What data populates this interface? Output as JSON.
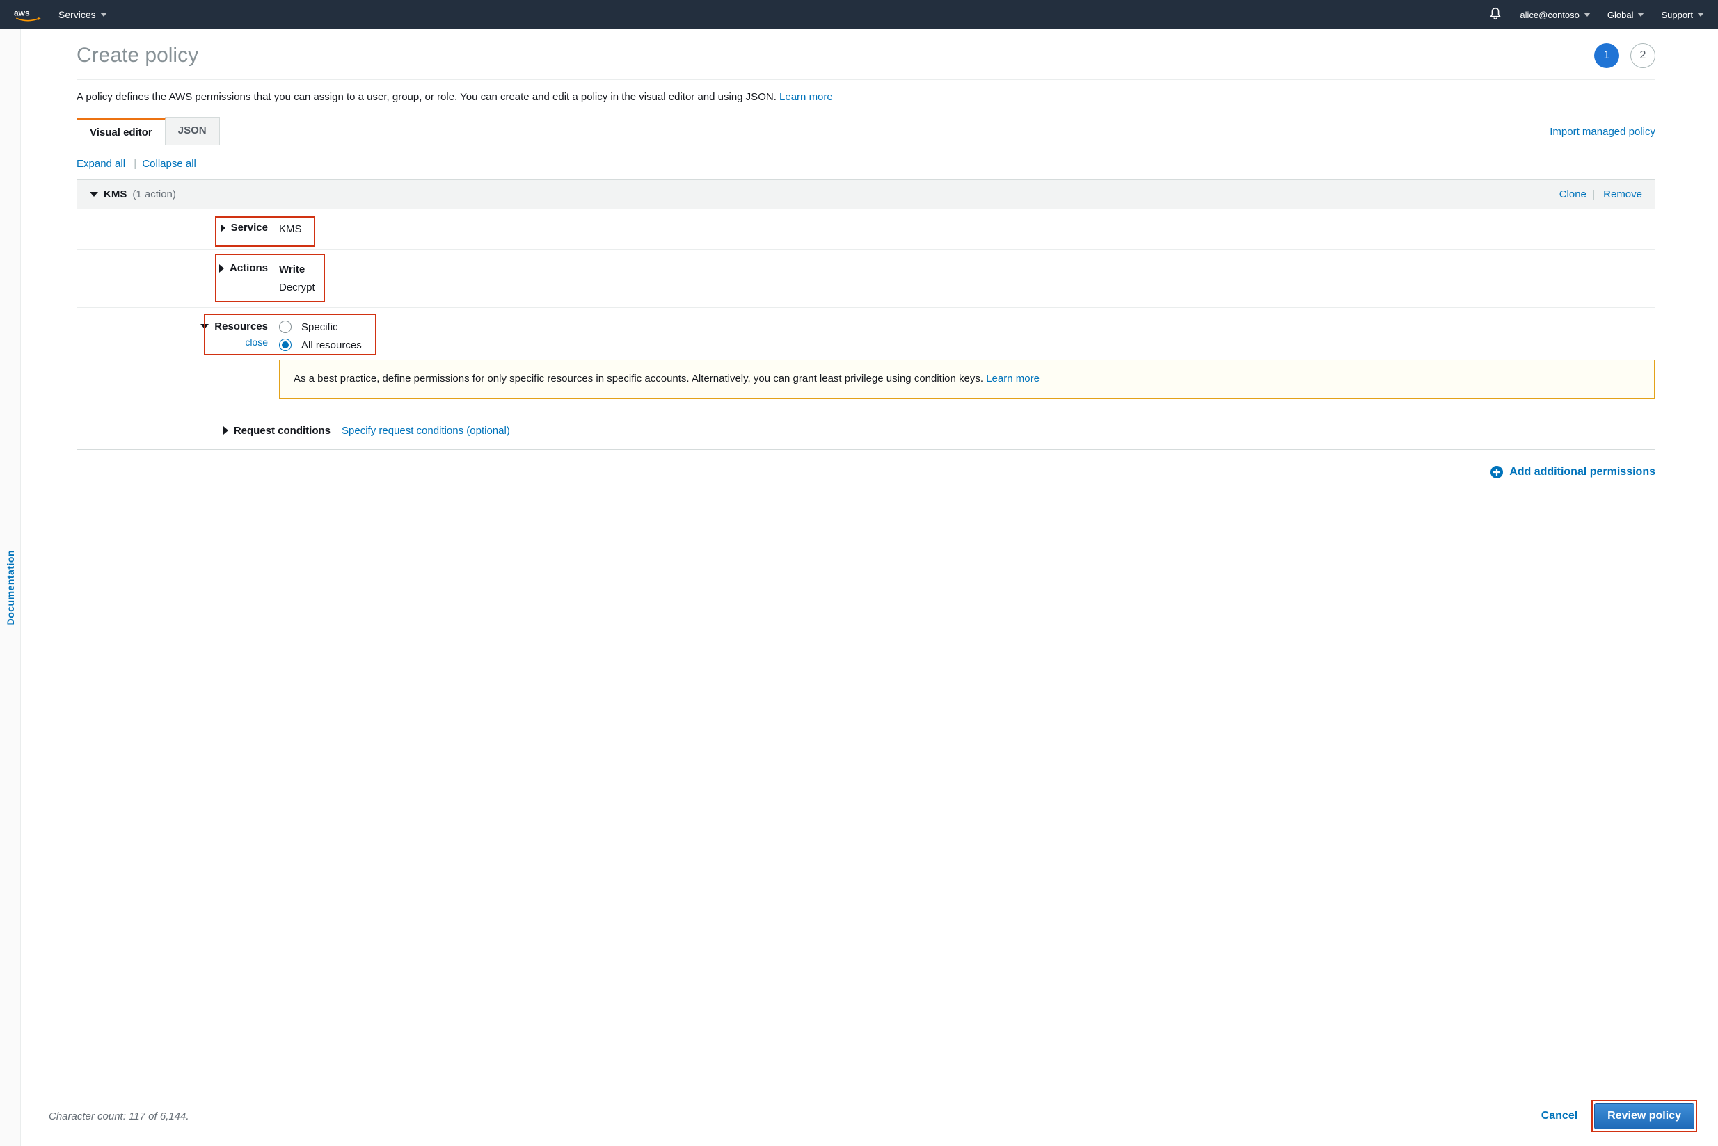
{
  "topnav": {
    "services": "Services",
    "user": "alice@contoso",
    "region": "Global",
    "support": "Support"
  },
  "sidebar": {
    "documentation": "Documentation"
  },
  "page": {
    "title": "Create policy",
    "step1": "1",
    "step2": "2",
    "intro": "A policy defines the AWS permissions that you can assign to a user, group, or role. You can create and edit a policy in the visual editor and using JSON. ",
    "learn_more": "Learn more"
  },
  "tabs": {
    "visual": "Visual editor",
    "json": "JSON",
    "import": "Import managed policy"
  },
  "toolbar": {
    "expand": "Expand all",
    "collapse": "Collapse all"
  },
  "block": {
    "service_name": "KMS",
    "count": "(1 action)",
    "clone": "Clone",
    "remove": "Remove",
    "service_label": "Service",
    "service_value": "KMS",
    "actions_label": "Actions",
    "actions_top": "Write",
    "actions_sub": "Decrypt",
    "resources_label": "Resources",
    "resources_close": "close",
    "radio_specific": "Specific",
    "radio_all": "All resources",
    "warning": "As a best practice, define permissions for only specific resources in specific accounts. Alternatively, you can grant least privilege using condition keys. ",
    "conditions_label": "Request conditions",
    "conditions_value": "Specify request conditions (optional)"
  },
  "add_permissions": "Add additional permissions",
  "footer": {
    "char_count": "Character count: 117 of 6,144.",
    "cancel": "Cancel",
    "review": "Review policy"
  }
}
